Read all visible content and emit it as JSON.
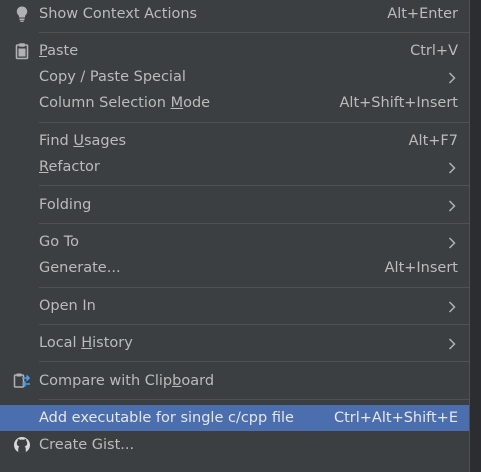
{
  "menu": {
    "items": [
      {
        "label": "Show Context Actions",
        "shortcut": "Alt+Enter",
        "icon": "lightbulb-icon"
      },
      {
        "label_pre": "",
        "label_u": "P",
        "label_post": "aste",
        "shortcut": "Ctrl+V",
        "icon": "clipboard-icon"
      },
      {
        "label": "Copy / Paste Special",
        "submenu": true
      },
      {
        "label_pre": "Column Selection ",
        "label_u": "M",
        "label_post": "ode",
        "shortcut": "Alt+Shift+Insert"
      },
      {
        "label_pre": "Find ",
        "label_u": "U",
        "label_post": "sages",
        "shortcut": "Alt+F7"
      },
      {
        "label_pre": "",
        "label_u": "R",
        "label_post": "efactor",
        "submenu": true
      },
      {
        "label": "Folding",
        "submenu": true
      },
      {
        "label": "Go To",
        "submenu": true
      },
      {
        "label": "Generate...",
        "shortcut": "Alt+Insert"
      },
      {
        "label": "Open In",
        "submenu": true
      },
      {
        "label_pre": "Local ",
        "label_u": "H",
        "label_post": "istory",
        "submenu": true
      },
      {
        "label_pre": "Compare with Clip",
        "label_u": "b",
        "label_post": "oard",
        "icon": "compare-clipboard-icon"
      },
      {
        "label": "Add executable for single c/cpp file",
        "shortcut": "Ctrl+Alt+Shift+E",
        "selected": true
      },
      {
        "label": "Create Gist...",
        "icon": "github-icon"
      }
    ]
  },
  "colors": {
    "background": "#3c3f41",
    "selection": "#4b6eaf",
    "text": "#bbbbbb",
    "separator": "#515151"
  }
}
